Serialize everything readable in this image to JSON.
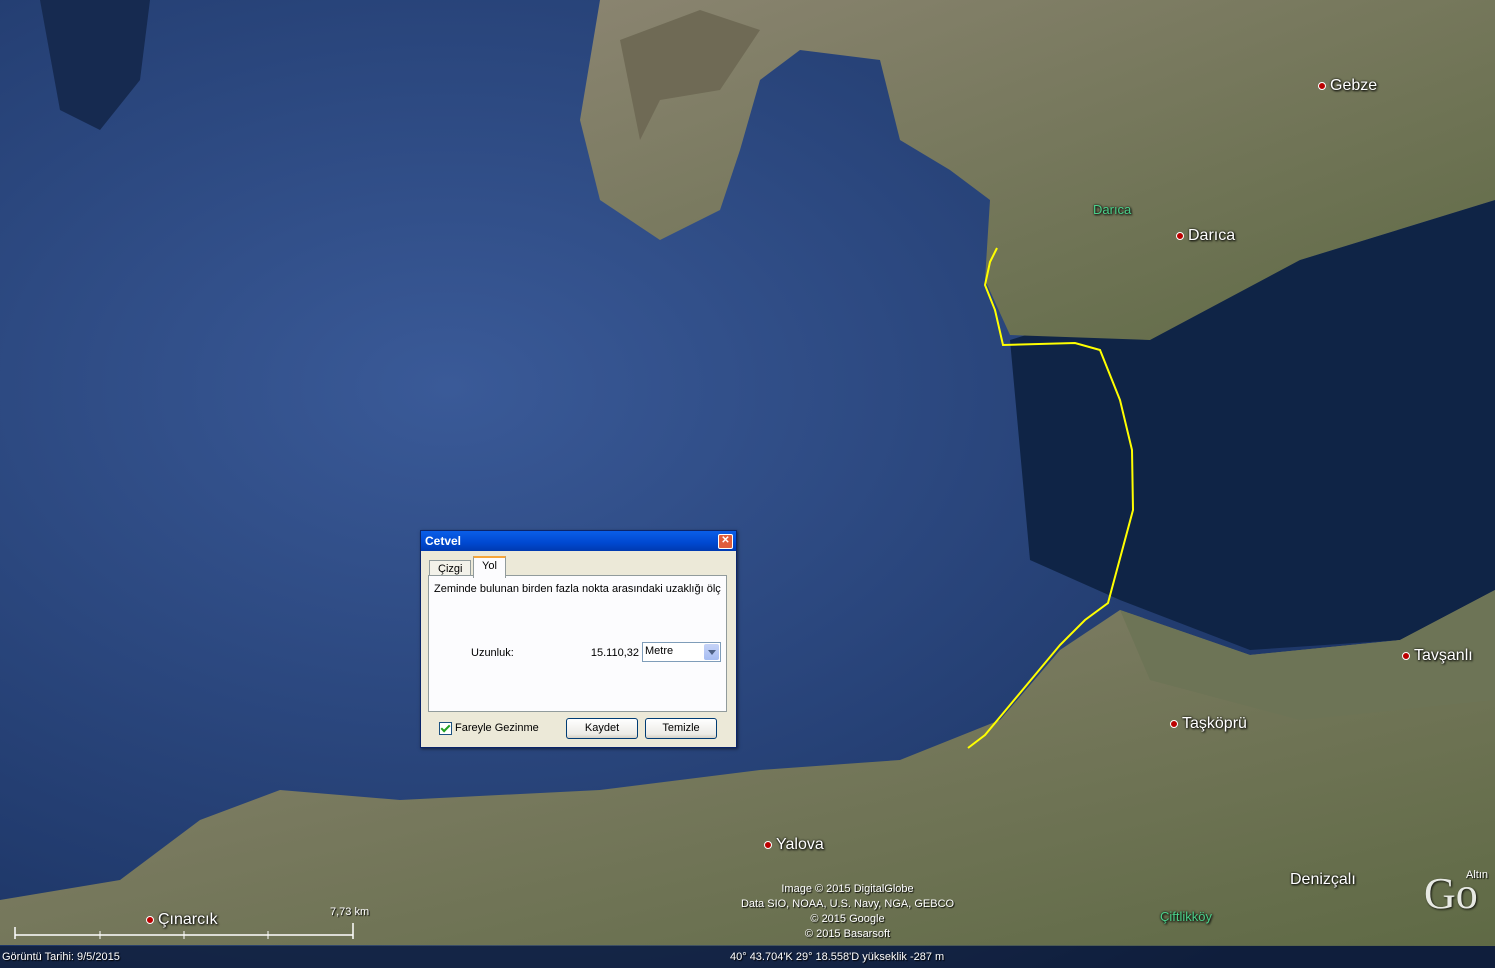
{
  "map": {
    "places": [
      {
        "id": "gebze",
        "label": "Gebze"
      },
      {
        "id": "darica",
        "label": "Darıca"
      },
      {
        "id": "darica-district",
        "label": "Darıca"
      },
      {
        "id": "tavsanli",
        "label": "Tavşanlı"
      },
      {
        "id": "taskopru",
        "label": "Taşköprü"
      },
      {
        "id": "yalova",
        "label": "Yalova"
      },
      {
        "id": "denizcali",
        "label": "Denizçalı"
      },
      {
        "id": "ciftlikkoy",
        "label": "Çiftlikköy"
      },
      {
        "id": "cinarcik",
        "label": "Çınarcık"
      }
    ],
    "credits": [
      "Image © 2015 DigitalGlobe",
      "Data SIO, NOAA, U.S. Navy, NGA, GEBCO",
      "© 2015 Google",
      "© 2015 Basarsoft"
    ],
    "scale_label": "7,73 km",
    "logo": "Go",
    "logo_small": "Altın",
    "status": {
      "image_date": "Görüntü Tarihi: 9/5/2015",
      "coords": "40° 43.704'K   29° 18.558'D  yükseklik  -287 m"
    },
    "colors": {
      "path": "#ffff00",
      "sea": "#1e3a6e",
      "land": "#7a7560"
    }
  },
  "dialog": {
    "title": "Cetvel",
    "tabs": [
      "Çizgi",
      "Yol"
    ],
    "active_tab": "Yol",
    "description": "Zeminde bulunan birden fazla nokta arasındaki uzaklığı ölç",
    "length_label": "Uzunluk:",
    "length_value": "15.110,32",
    "unit": "Metre",
    "checkbox_label": "Fareyle Gezinme",
    "checkbox_checked": true,
    "save_label": "Kaydet",
    "clear_label": "Temizle"
  }
}
